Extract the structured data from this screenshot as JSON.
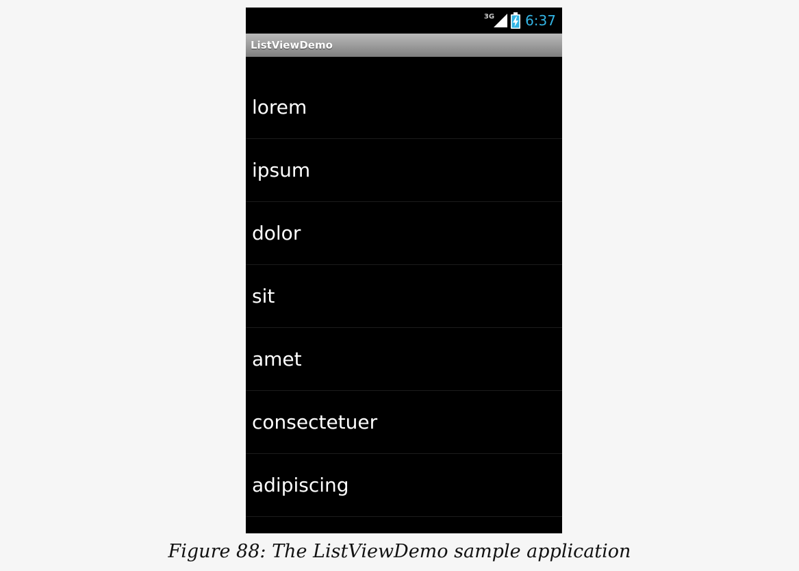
{
  "status_bar": {
    "network_type": "3G",
    "time": "6:37",
    "signal_icon": "cell-signal-icon",
    "battery_icon": "battery-charging-icon",
    "time_color": "#33b5e5"
  },
  "action_bar": {
    "title": "ListViewDemo"
  },
  "list": {
    "items": [
      {
        "label": "lorem"
      },
      {
        "label": "ipsum"
      },
      {
        "label": "dolor"
      },
      {
        "label": "sit"
      },
      {
        "label": "amet"
      },
      {
        "label": "consectetuer"
      },
      {
        "label": "adipiscing"
      }
    ]
  },
  "caption": "Figure 88: The ListViewDemo sample application"
}
